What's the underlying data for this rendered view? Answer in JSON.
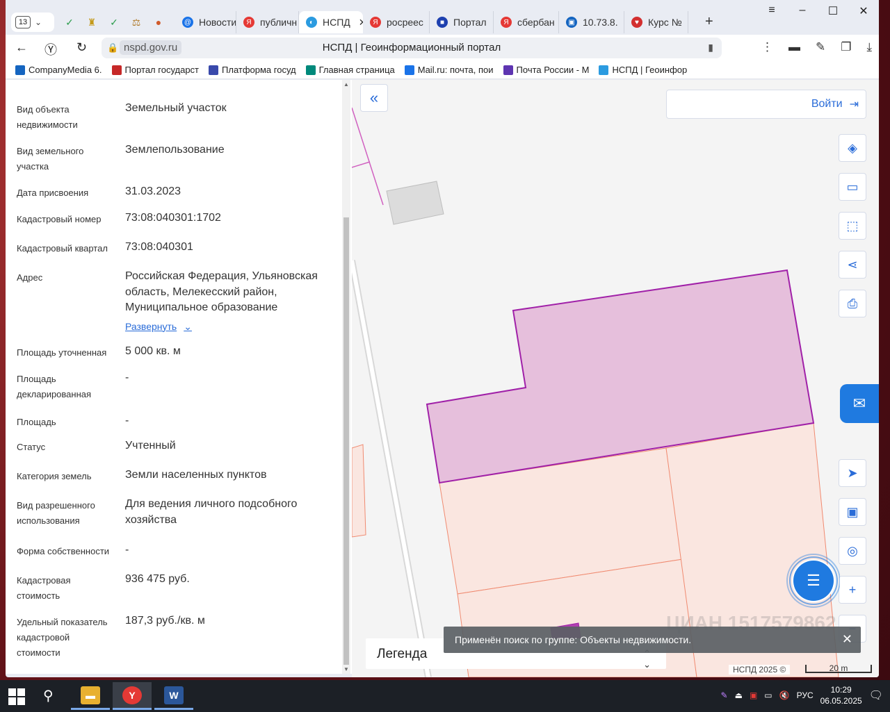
{
  "browser": {
    "tab_count": "13",
    "tabs": [
      {
        "label": "Новости",
        "fav_color": "#1a73e8",
        "fav_glyph": "@"
      },
      {
        "label": "публичн",
        "fav_color": "#e53935",
        "fav_glyph": "Я"
      },
      {
        "label": "НСПД",
        "fav_color": "#2b9be0",
        "fav_glyph": "◐",
        "active": true
      },
      {
        "label": "росреес",
        "fav_color": "#e53935",
        "fav_glyph": "Я"
      },
      {
        "label": "Портал",
        "fav_color": "#1e40af",
        "fav_glyph": "■"
      },
      {
        "label": "сбербан",
        "fav_color": "#e53935",
        "fav_glyph": "Я"
      },
      {
        "label": "10.73.8.",
        "fav_color": "#1565c0",
        "fav_glyph": "▣"
      },
      {
        "label": "Курс №",
        "fav_color": "#d32f2f",
        "fav_glyph": "♥"
      }
    ],
    "url": "nspd.gov.ru",
    "page_title": "НСПД | Геоинформационный портал",
    "bookmarks": [
      {
        "label": "CompanyMedia 6.",
        "color": "#1565c0"
      },
      {
        "label": "Портал государст",
        "color": "#c62828"
      },
      {
        "label": "Платформа госуд",
        "color": "#3949ab"
      },
      {
        "label": "Главная страница",
        "color": "#00897b"
      },
      {
        "label": "Mail.ru: почта, пои",
        "color": "#1a73e8"
      },
      {
        "label": "Почта России - М",
        "color": "#5e35b1"
      },
      {
        "label": "НСПД | Геоинфор",
        "color": "#2b9be0"
      }
    ]
  },
  "panel": {
    "rows": [
      {
        "label": "Вид объекта недвижимости",
        "value": "Земельный участок"
      },
      {
        "label": "Вид земельного участка",
        "value": "Землепользование"
      },
      {
        "label": "Дата присвоения",
        "value": "31.03.2023"
      },
      {
        "label": "Кадастровый номер",
        "value": "73:08:040301:1702"
      },
      {
        "label": "Кадастровый квартал",
        "value": "73:08:040301"
      },
      {
        "label": "Адрес",
        "value": "Российская Федерация, Ульяновская область, Мелекесский район, Муниципальное образование"
      },
      {
        "label": "Площадь уточненная",
        "value": "5 000 кв. м"
      },
      {
        "label": "Площадь декларированная",
        "value": "-"
      },
      {
        "label": "Площадь",
        "value": "-"
      },
      {
        "label": "Статус",
        "value": "Учтенный"
      },
      {
        "label": "Категория земель",
        "value": "Земли населенных пунктов"
      },
      {
        "label": "Вид разрешенного использования",
        "value": "Для ведения личного подсобного хозяйства"
      },
      {
        "label": "Форма собственности",
        "value": "-"
      },
      {
        "label": "Кадастровая стоимость",
        "value": "936 475 руб."
      },
      {
        "label": "Удельный показатель кадастровой стоимости",
        "value": "187,3 руб./кв. м"
      }
    ],
    "expand_label": "Развернуть"
  },
  "map": {
    "login_label": "Войти",
    "legend_label": "Легенда",
    "toast": "Применён поиск по группе: Объекты недвижимости.",
    "attribution": "НСПД 2025 ©",
    "scale_label": "20 m",
    "watermark": "ЦИАН 1517579862",
    "colors": {
      "selected_fill": "#e6bfdc",
      "selected_stroke": "#a020a8",
      "parcel_fill": "#fae6e0",
      "parcel_stroke": "#f08a70",
      "accent": "#2a6cd8"
    }
  },
  "taskbar": {
    "lang": "РУС",
    "time": "10:29",
    "date": "06.05.2025"
  }
}
